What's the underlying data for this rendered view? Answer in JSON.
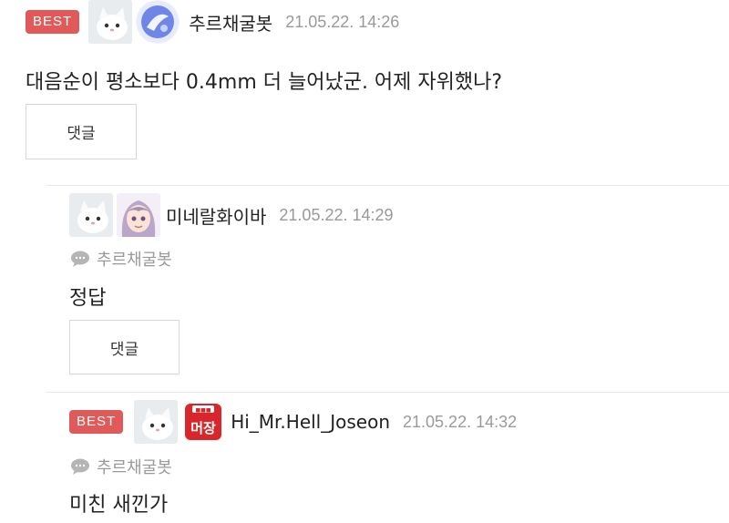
{
  "colors": {
    "best_badge": "#e05a5a",
    "meta_gray": "#9a9a9a",
    "divider": "#e8e8e8"
  },
  "comments": [
    {
      "badge": "BEST",
      "author": "추르채굴봇",
      "time": "21.05.22. 14:26",
      "text": "대음순이 평소보다 0.4mm 더 늘어났군. 어제 자위했나?",
      "reply_label": "댓글",
      "avatars": [
        "white-cat-avatar",
        "sky-emblem-avatar"
      ]
    },
    {
      "author": "미네랄화이바",
      "time": "21.05.22. 14:29",
      "mention": "추르채굴봇",
      "text": "정답",
      "reply_label": "댓글",
      "avatars": [
        "white-cat-avatar",
        "anime-girl-avatar"
      ]
    },
    {
      "badge": "BEST",
      "author": "Hi_Mr.Hell_Joseon",
      "time": "21.05.22. 14:32",
      "mention": "추르채굴봇",
      "text": "미친 새낀가",
      "avatars": [
        "white-cat-avatar",
        "red-emblem-avatar"
      ],
      "emblem_top": "■■■",
      "emblem_text": "머장"
    }
  ]
}
